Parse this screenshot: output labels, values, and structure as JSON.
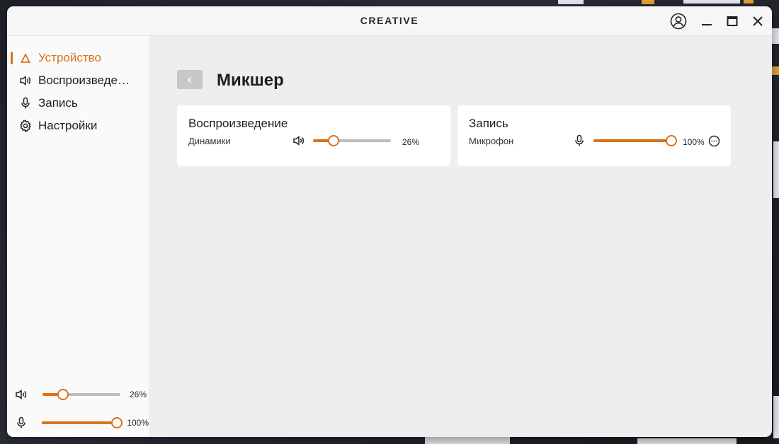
{
  "window": {
    "logo": "CREATIVE"
  },
  "sidebar": {
    "items": [
      {
        "label": "Устройство",
        "icon": "creative-device-icon",
        "active": true
      },
      {
        "label": "Воспроизведение",
        "icon": "speaker-icon",
        "active": false
      },
      {
        "label": "Запись",
        "icon": "microphone-icon",
        "active": false
      },
      {
        "label": "Настройки",
        "icon": "gear-icon",
        "active": false
      }
    ],
    "playback_volume": {
      "value": 26,
      "label": "26%"
    },
    "record_volume": {
      "value": 100,
      "label": "100%"
    }
  },
  "main": {
    "title": "Микшер",
    "cards": [
      {
        "title": "Воспроизведение",
        "device": "Динамики",
        "icon": "speaker-icon",
        "value": 26,
        "label": "26%"
      },
      {
        "title": "Запись",
        "device": "Микрофон",
        "icon": "microphone-icon",
        "value": 100,
        "label": "100%",
        "more_icon": "more-options-icon"
      }
    ]
  },
  "colors": {
    "accent": "#d9731a",
    "track": "#bdbdbd"
  }
}
